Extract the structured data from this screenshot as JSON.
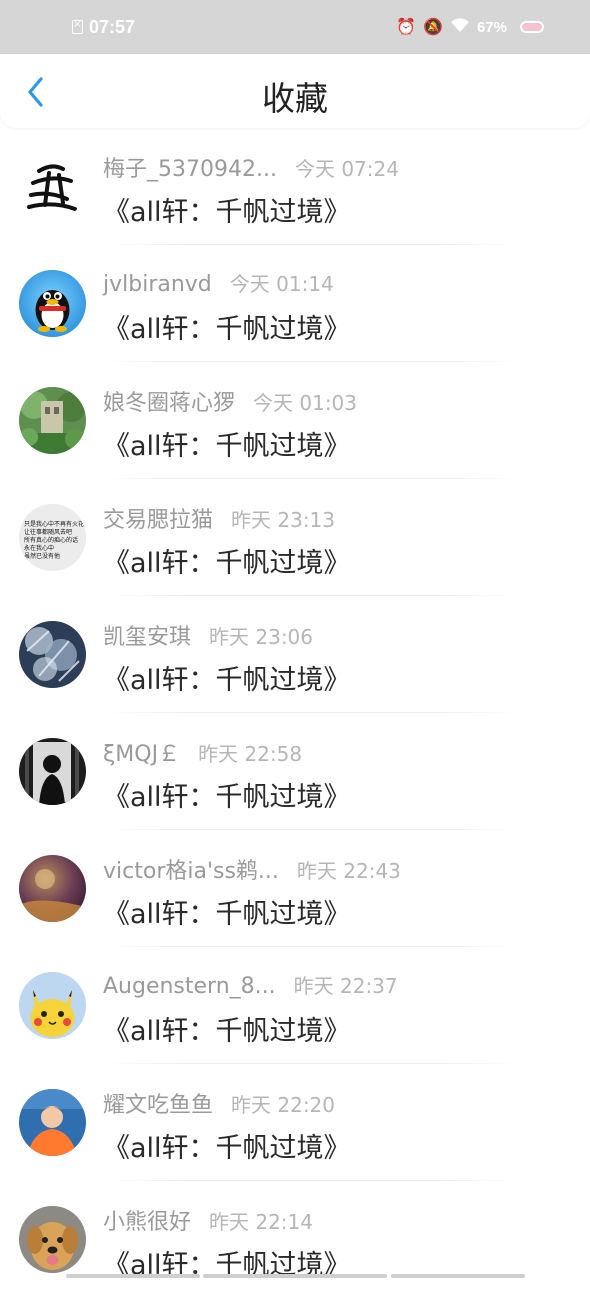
{
  "status_bar": {
    "time": "07:57",
    "battery": "67%",
    "icons": [
      "sim-off-icon",
      "alarm-icon",
      "silent-icon",
      "wifi-icon",
      "battery-icon"
    ]
  },
  "header": {
    "title": "收藏",
    "back_icon": "chevron-left-icon",
    "accent_color": "#2b9ae6"
  },
  "items": [
    {
      "username": "梅子_5370942...",
      "time": "今天 07:24",
      "title": "《all轩：千帆过境》"
    },
    {
      "username": "jvlbiranvd",
      "time": "今天 01:14",
      "title": "《all轩：千帆过境》"
    },
    {
      "username": "娘冬圈蒋心猡",
      "time": "今天 01:03",
      "title": "《all轩：千帆过境》"
    },
    {
      "username": "交易腮拉猫",
      "time": "昨天 23:13",
      "title": "《all轩：千帆过境》",
      "avatar_text": [
        "只是我心中不再有火花",
        "让往事都随风去吧",
        "所有真心的痴心的话",
        "永在我心中",
        "虽然已没有他"
      ]
    },
    {
      "username": "凯玺安琪",
      "time": "昨天 23:06",
      "title": "《all轩：千帆过境》"
    },
    {
      "username": "ξMQJ￡",
      "time": "昨天 22:58",
      "title": "《all轩：千帆过境》"
    },
    {
      "username": "victor格ia'ss鹈...",
      "time": "昨天 22:43",
      "title": "《all轩：千帆过境》"
    },
    {
      "username": "Augenstern_8...",
      "time": "昨天 22:37",
      "title": "《all轩：千帆过境》"
    },
    {
      "username": "耀文吃鱼鱼",
      "time": "昨天 22:20",
      "title": "《all轩：千帆过境》"
    },
    {
      "username": "小熊很好",
      "time": "昨天 22:14",
      "title": "《all轩：千帆过境》"
    }
  ]
}
